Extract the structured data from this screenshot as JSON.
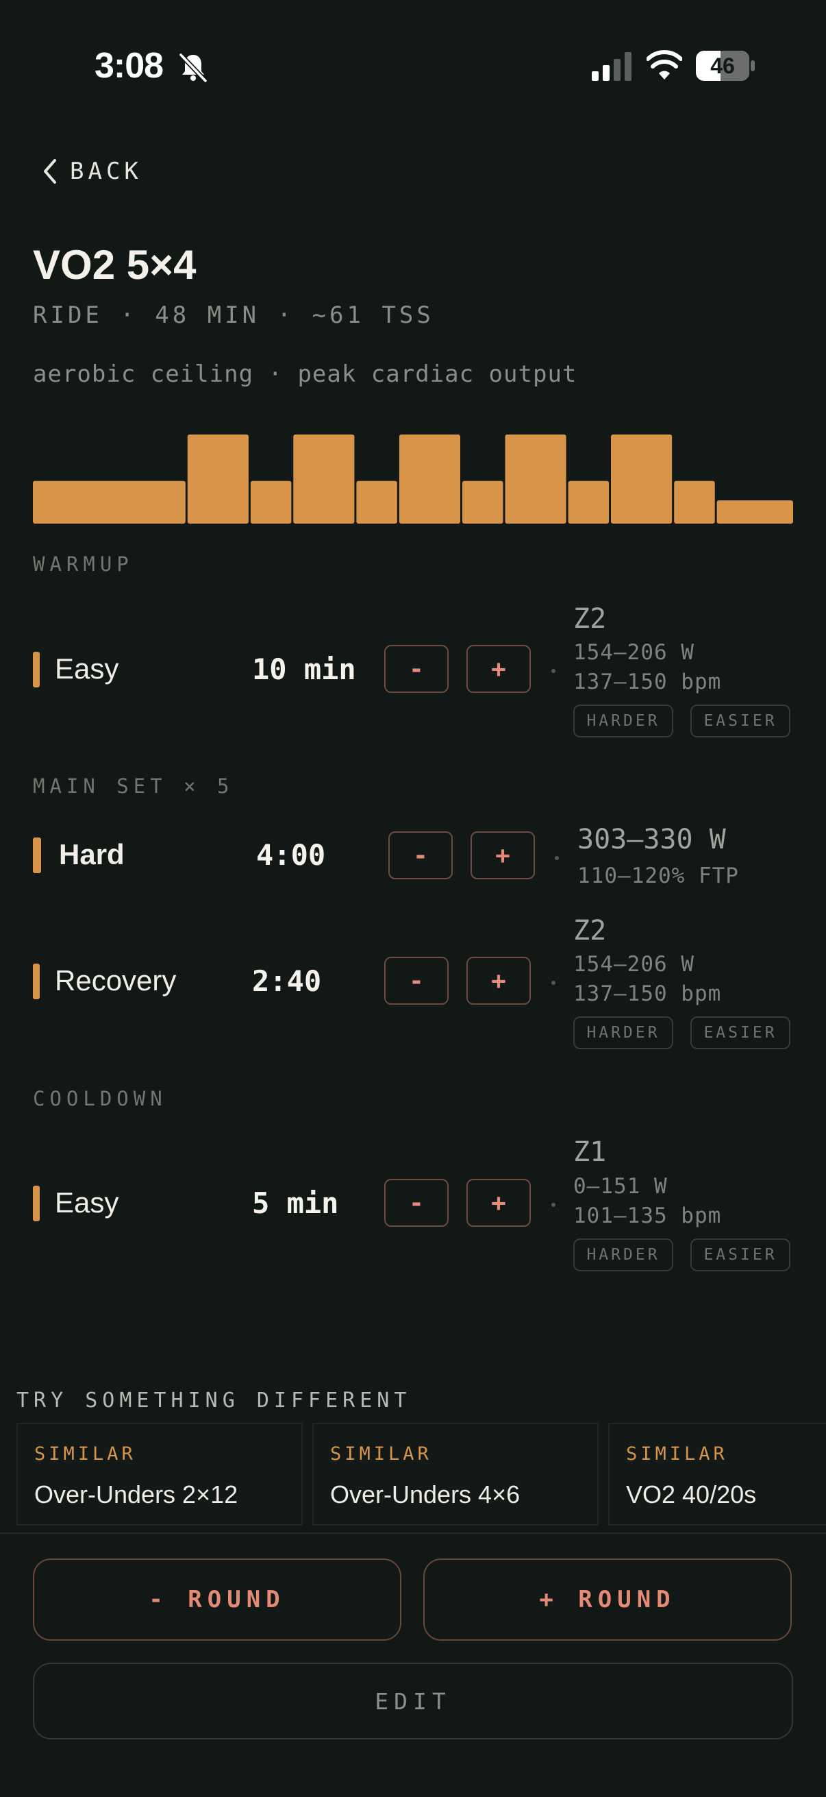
{
  "status": {
    "time": "3:08",
    "battery": "46"
  },
  "nav": {
    "back_label": "BACK"
  },
  "workout": {
    "title": "VO2 5×4",
    "meta": "RIDE · 48 MIN · ~61 TSS",
    "description": "aerobic ceiling · peak cardiac output"
  },
  "profile_bars": [
    {
      "duration": 10,
      "intensity": 0.55
    },
    {
      "duration": 4,
      "intensity": 1.15
    },
    {
      "duration": 2.67,
      "intensity": 0.55
    },
    {
      "duration": 4,
      "intensity": 1.15
    },
    {
      "duration": 2.67,
      "intensity": 0.55
    },
    {
      "duration": 4,
      "intensity": 1.15
    },
    {
      "duration": 2.67,
      "intensity": 0.55
    },
    {
      "duration": 4,
      "intensity": 1.15
    },
    {
      "duration": 2.67,
      "intensity": 0.55
    },
    {
      "duration": 4,
      "intensity": 1.15
    },
    {
      "duration": 2.67,
      "intensity": 0.55
    },
    {
      "duration": 5,
      "intensity": 0.3
    }
  ],
  "sections": {
    "warmup": "WARMUP",
    "main": "MAIN SET × 5",
    "cooldown": "COOLDOWN"
  },
  "steps": {
    "warmup": {
      "name": "Easy",
      "duration": "10 min",
      "zone": "Z2",
      "power": "154–206 W",
      "hr": "137–150 bpm"
    },
    "hard": {
      "name": "Hard",
      "duration": "4:00",
      "power": "303–330 W",
      "ftp": "110–120% FTP"
    },
    "recovery": {
      "name": "Recovery",
      "duration": "2:40",
      "zone": "Z2",
      "power": "154–206 W",
      "hr": "137–150 bpm"
    },
    "cooldown": {
      "name": "Easy",
      "duration": "5 min",
      "zone": "Z1",
      "power": "0–151 W",
      "hr": "101–135 bpm"
    }
  },
  "controls": {
    "minus": "-",
    "plus": "+",
    "harder": "HARDER",
    "easier": "EASIER"
  },
  "suggestions": {
    "heading": "TRY SOMETHING DIFFERENT",
    "items": [
      {
        "tag": "SIMILAR",
        "name": "Over-Unders 2×12"
      },
      {
        "tag": "SIMILAR",
        "name": "Over-Unders 4×6"
      },
      {
        "tag": "SIMILAR",
        "name": "VO2 40/20s"
      }
    ]
  },
  "actions": {
    "minus_round": "- ROUND",
    "plus_round": "+ ROUND",
    "edit": "EDIT"
  },
  "colors": {
    "accent": "#d8954a",
    "control": "#e58a77",
    "background": "#121815"
  }
}
